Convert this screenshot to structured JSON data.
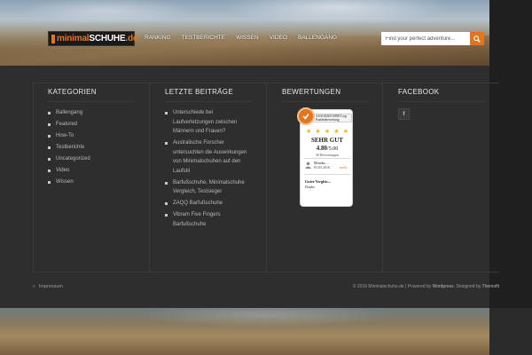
{
  "header": {
    "logo": {
      "part1": "minimal",
      "part2": "SCHUHE",
      "part3": ".de"
    },
    "nav": [
      "RANKING",
      "TESTBERICHTE",
      "WISSEN",
      "VIDEO",
      "BALLENGANG"
    ],
    "search": {
      "placeholder": "Find your perfect adventure...",
      "icon": "search-icon"
    }
  },
  "footer": {
    "categories": {
      "title": "KATEGORIEN",
      "items": [
        "Ballengang",
        "Featured",
        "How-To",
        "Testberichte",
        "Uncategorized",
        "Video",
        "Wissen"
      ]
    },
    "recent_posts": {
      "title": "LETZTE BEITRÄGE",
      "items": [
        "Unterschiede bei Laufverletzungen zwischen Männern und Frauen?",
        "Australische Forscher untersuchten die Auswirkungen von Minimalschuhen auf den Laufstil",
        "Barfußschuhe, Minimalschuhe Vergleich, Testsieger",
        "ZAQQ Barfußschuhe",
        "Vibram Five Fingers Barfußschuhe"
      ]
    },
    "ratings": {
      "title": "BEWERTUNGEN",
      "widget": {
        "header_line1": "AUSGEZEICHNET.org",
        "header_line2": "Kundenbewertung",
        "verdict": "SEHR GUT",
        "score": "4.80",
        "score_max": "/5.00",
        "count": "30 Bewertungen",
        "reviewer": "Monika, ...",
        "date": "03.03.2016",
        "more": "mehr",
        "review_title": "Guter Vergleic...",
        "review_text": "Danke",
        "stars": 5
      }
    },
    "facebook": {
      "title": "FACEBOOK",
      "button": "f"
    },
    "bottom": {
      "impressum": "Impressum",
      "copyright_prefix": "© 2016 Minimalschuhe.de | Powered by ",
      "wordpress": "Wordpress",
      "designed_by": ". Designed by ",
      "themefit": "Themofit"
    }
  },
  "colors": {
    "accent": "#e2751f",
    "footer_bg": "#2e2e2e",
    "text": "#b8b8b8"
  }
}
